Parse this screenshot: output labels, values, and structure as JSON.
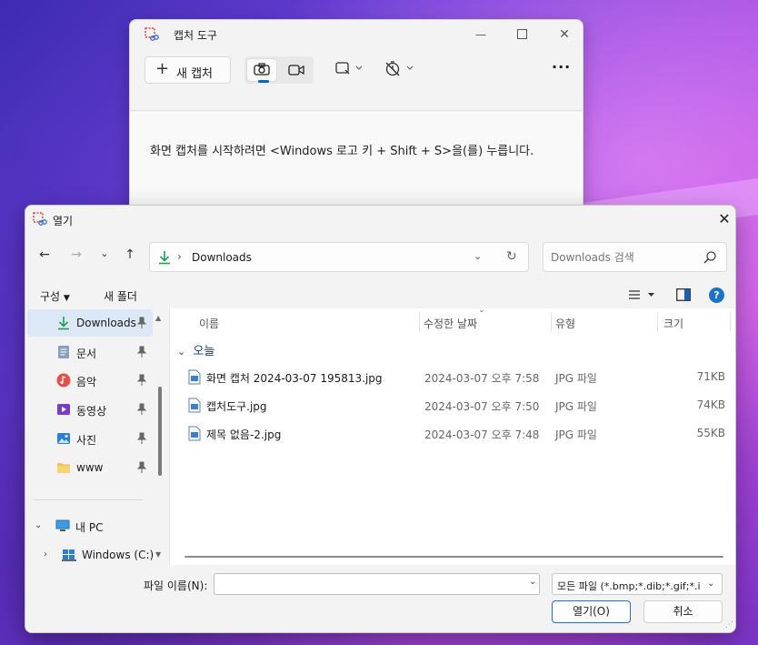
{
  "snipping_tool": {
    "title": "캡처 도구",
    "new_capture_label": "새 캡처",
    "instruction": "화면 캡처를 시작하려면 <Windows 로고 키 + Shift + S>을(를) 누릅니다.",
    "accent": "#0067c0"
  },
  "open_dialog": {
    "title": "열기",
    "address": {
      "current": "Downloads"
    },
    "search": {
      "placeholder": "Downloads 검색"
    },
    "commands": {
      "organize": "구성",
      "new_folder": "새 폴더",
      "help": "?"
    },
    "nav": {
      "quick_access": [
        {
          "label": "Downloads",
          "icon": "download-arrow-icon",
          "selected": true
        },
        {
          "label": "문서",
          "icon": "document-icon"
        },
        {
          "label": "음악",
          "icon": "music-icon"
        },
        {
          "label": "동영상",
          "icon": "video-icon"
        },
        {
          "label": "사진",
          "icon": "picture-icon"
        },
        {
          "label": "www",
          "icon": "folder-icon"
        }
      ],
      "this_pc": "내 PC",
      "drive": "Windows (C:)"
    },
    "columns": {
      "name": "이름",
      "date": "수정한 날짜",
      "type": "유형",
      "size": "크기"
    },
    "group": "오늘",
    "files": [
      {
        "name": "화면 캡처 2024-03-07 195813.jpg",
        "date": "2024-03-07 오후 7:58",
        "type": "JPG 파일",
        "size": "71KB"
      },
      {
        "name": "캡처도구.jpg",
        "date": "2024-03-07 오후 7:50",
        "type": "JPG 파일",
        "size": "74KB"
      },
      {
        "name": "제목 없음-2.jpg",
        "date": "2024-03-07 오후 7:48",
        "type": "JPG 파일",
        "size": "55KB"
      }
    ],
    "bottom": {
      "filename_label": "파일 이름(N):",
      "filename_value": "",
      "filter": "모든 파일 (*.bmp;*.dib;*.gif;*.ic",
      "open_button": "열기(O)",
      "cancel_button": "취소"
    }
  }
}
